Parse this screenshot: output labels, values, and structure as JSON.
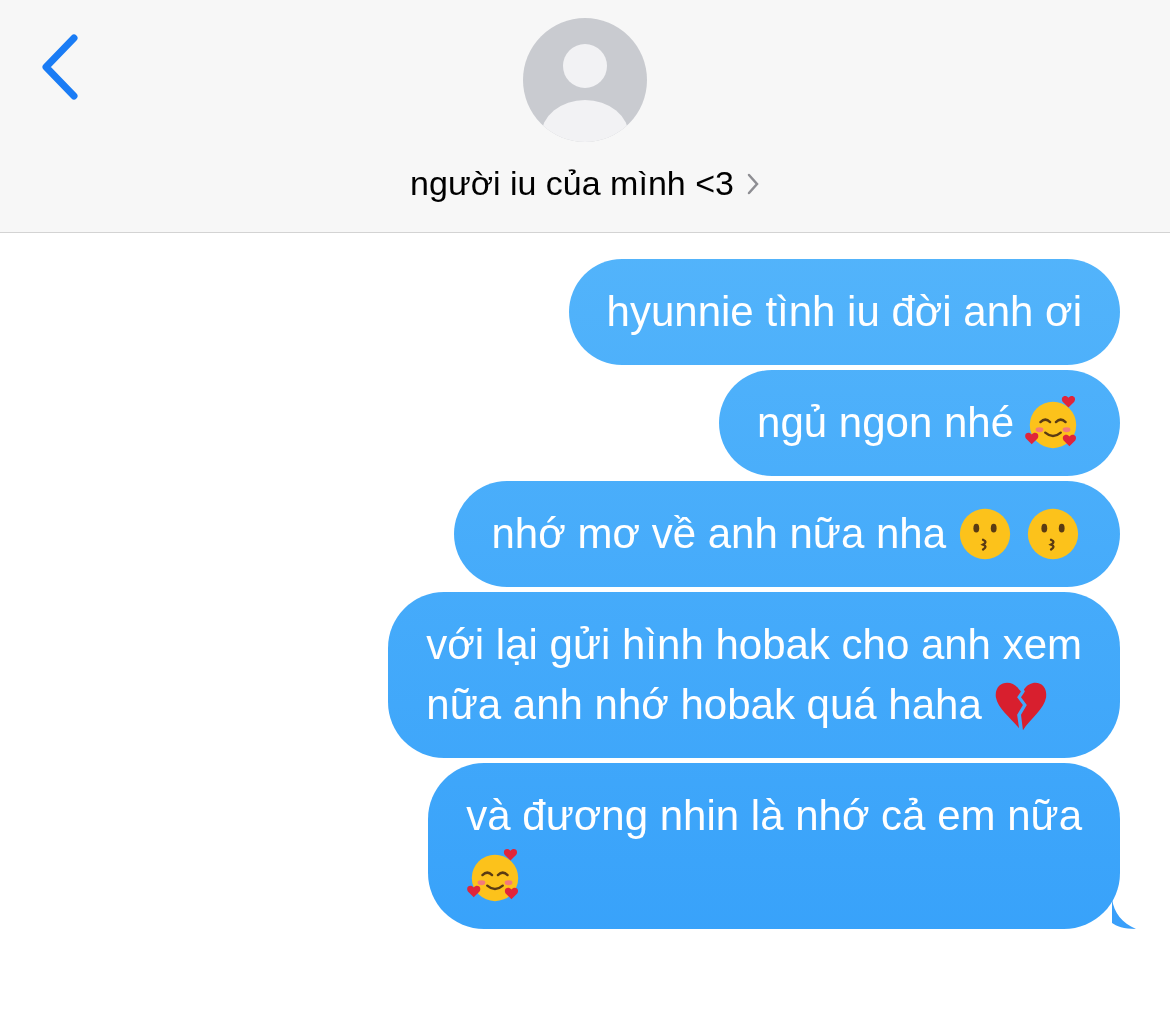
{
  "header": {
    "contact_name": "người iu của mình <3"
  },
  "messages": [
    {
      "tail": false,
      "lines": [
        {
          "text": "hyunnie tình iu đời anh ơi"
        }
      ]
    },
    {
      "tail": false,
      "lines": [
        {
          "text": "ngủ ngon nhé",
          "emoji": [
            {
              "kind": "hearts-face"
            }
          ]
        }
      ]
    },
    {
      "tail": false,
      "lines": [
        {
          "text": "nhớ mơ về anh nữa nha",
          "emoji": [
            {
              "kind": "kiss-face"
            },
            {
              "kind": "kiss-face"
            }
          ]
        }
      ]
    },
    {
      "tail": false,
      "lines": [
        {
          "text": "với lại gửi hình hobak cho anh xem"
        },
        {
          "text": "nữa anh nhớ hobak quá haha",
          "emoji": [
            {
              "kind": "broken-heart"
            }
          ]
        }
      ]
    },
    {
      "tail": true,
      "lines": [
        {
          "text": "và đương nhin là nhớ cả em nữa"
        },
        {
          "emoji": [
            {
              "kind": "hearts-face"
            }
          ]
        }
      ]
    }
  ]
}
